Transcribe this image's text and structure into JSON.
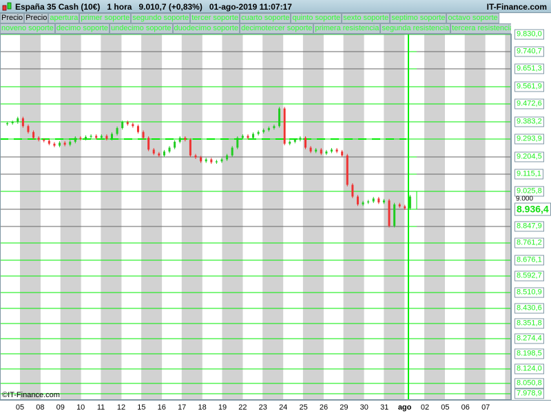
{
  "title": {
    "instrument": "España 35 Cash (10€)",
    "timeframe": "1 hora",
    "price": "9.010,7 (+0,83%)",
    "datetime": "01-ago-2019 11:07:17",
    "brand": "IT-Finance.com"
  },
  "legend_row1": [
    "Precio",
    "Precio",
    "apertura",
    "primer soporte",
    "segundo soporte",
    "tercer soporte",
    "cuarto soporte",
    "quinto soporte",
    "sexto soporte",
    "septimo soporte",
    "octavo soporte"
  ],
  "legend_row2": [
    "noveno soporte",
    "decimo soporte",
    "undecimo soporte",
    "duodecimo soporte",
    "decimotercer soporte",
    "primera resistencia",
    "segunda resistencia",
    "tercera resistencia"
  ],
  "price_labels": [
    "9.830,0",
    "9.740,7",
    "9.651,3",
    "9.561,9",
    "9.472,6",
    "9.383,2",
    "9.293,9",
    "9.204,5",
    "9.115,1",
    "9.025,8",
    "8.936,4",
    "8.847,9",
    "8.761,2",
    "8.676,1",
    "8.592,7",
    "8.510,9",
    "8.430,6",
    "8.351,8",
    "8.274,4",
    "8.198,5",
    "8.124,0",
    "8.050,8",
    "7.978,9"
  ],
  "current_price_label": "8.936,4",
  "hidden_label": "9.000",
  "x_labels": [
    "05",
    "08",
    "09",
    "10",
    "11",
    "12",
    "15",
    "16",
    "17",
    "18",
    "19",
    "22",
    "23",
    "24",
    "25",
    "26",
    "29",
    "30",
    "31",
    "ago",
    "02",
    "05",
    "06",
    "07"
  ],
  "copyright": "©IT-Finance.com",
  "colors": {
    "up": "#22cc22",
    "down": "#ee3333",
    "level": "#00ee00",
    "grid": "#666666",
    "stripe": "#d2d2d2"
  },
  "chart_data": {
    "type": "line",
    "opening_level": 9293.9,
    "series": [
      9370,
      9375,
      9380,
      9400,
      9360,
      9330,
      9300,
      9290,
      9285,
      9270,
      9260,
      9275,
      9265,
      9280,
      9300,
      9295,
      9305,
      9310,
      9300,
      9310,
      9295,
      9320,
      9350,
      9380,
      9370,
      9360,
      9330,
      9300,
      9240,
      9220,
      9210,
      9230,
      9250,
      9280,
      9300,
      9290,
      9210,
      9200,
      9180,
      9190,
      9175,
      9180,
      9190,
      9210,
      9250,
      9300,
      9310,
      9300,
      9320,
      9330,
      9340,
      9350,
      9360,
      9450,
      9270,
      9280,
      9290,
      9300,
      9250,
      9230,
      9240,
      9220,
      9230,
      9240,
      9230,
      9210,
      9060,
      9000,
      8960,
      8970,
      8975,
      8990,
      8970,
      8980,
      8850,
      8960,
      8950,
      8940,
      9000
    ]
  }
}
